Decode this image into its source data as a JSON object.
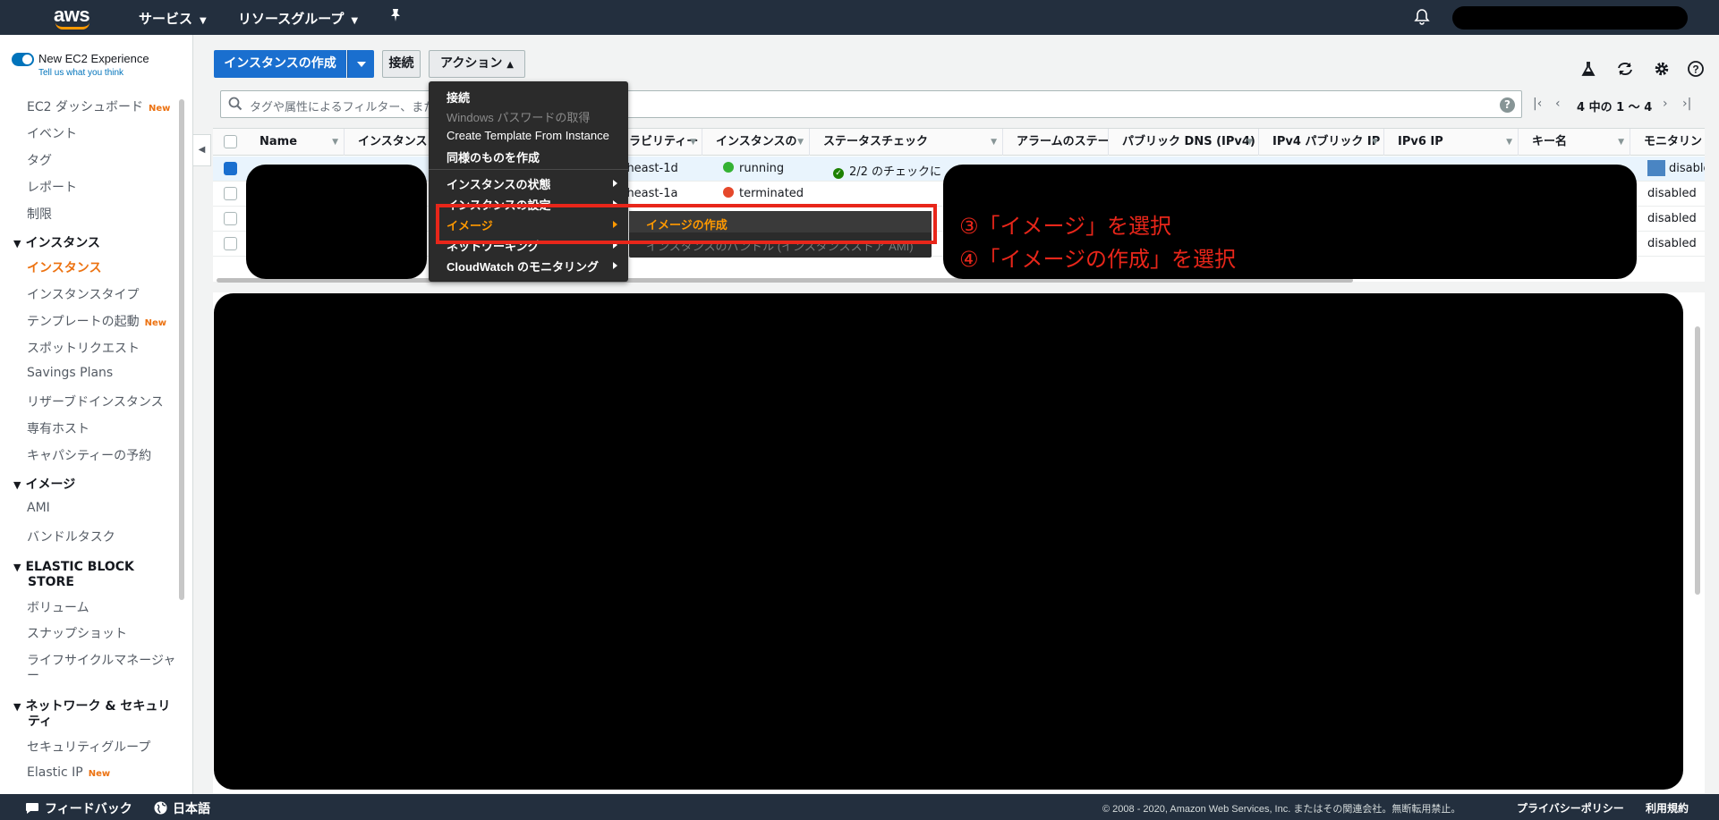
{
  "topnav": {
    "logo": "aws",
    "services": "サービス",
    "resource_groups": "リソースグループ",
    "pin_icon": "pin-icon",
    "bell_icon": "bell-icon"
  },
  "sidebar": {
    "ec2_experience": "New EC2 Experience",
    "feedback_link": "Tell us what you think",
    "new_badge": "New",
    "items_top": [
      "EC2 ダッシュボード",
      "イベント",
      "タグ",
      "レポート",
      "制限"
    ],
    "section_instances": "インスタンス",
    "items_instances": [
      "インスタンス",
      "インスタンスタイプ",
      "テンプレートの起動",
      "スポットリクエスト",
      "Savings Plans",
      "リザーブドインスタンス",
      "専有ホスト",
      "キャパシティーの予約"
    ],
    "section_images": "イメージ",
    "items_images": [
      "AMI",
      "バンドルタスク"
    ],
    "section_ebs_line1": "ELASTIC BLOCK",
    "section_ebs_line2": "STORE",
    "items_ebs": [
      "ボリューム",
      "スナップショット",
      "ライフサイクルマネージャ",
      "ー"
    ],
    "section_network_line1": "ネットワーク & セキュリ",
    "section_network_line2": "ティ",
    "items_network": [
      "セキュリティグループ",
      "Elastic IP"
    ]
  },
  "toolbar": {
    "launch": "インスタンスの作成",
    "connect": "接続",
    "actions": "アクション"
  },
  "filter": {
    "placeholder": "タグや属性によるフィルター、また",
    "pagination": "4 中の 1 〜 4"
  },
  "table": {
    "columns": [
      "Name",
      "インスタンス",
      "イラビリティー",
      "インスタンスの",
      "ステータスチェック",
      "アラームのステー",
      "パブリック DNS (IPv4)",
      "IPv4 パブリック IP",
      "IPv6 IP",
      "キー名",
      "モニタリン"
    ],
    "rows": [
      {
        "az": "rtheast-1d",
        "state": "running",
        "state_color": "#34b233",
        "status_check": "2/2 のチェックに",
        "monitoring": "disable",
        "selected": true
      },
      {
        "az": "rtheast-1a",
        "state": "terminated",
        "state_color": "#e5482b",
        "status_check": "",
        "monitoring": "disabled",
        "selected": false
      },
      {
        "az": "",
        "state": "",
        "status_check": "",
        "monitoring": "disabled",
        "selected": false
      },
      {
        "az": "",
        "state": "",
        "status_check": "",
        "monitoring": "disabled",
        "selected": false
      }
    ]
  },
  "action_menu": {
    "items": [
      "接続",
      "Windows パスワードの取得",
      "Create Template From Instance",
      "同様のものを作成",
      "インスタンスの状態",
      "インスタンスの設定",
      "イメージ",
      "ネットワーキング",
      "CloudWatch のモニタリング"
    ],
    "submenu": [
      "イメージの作成",
      "インスタンスのバンドル (インスタンスストア AMI)"
    ]
  },
  "annotations": {
    "step3": "③「イメージ」を選択",
    "step4": "④「イメージの作成」を選択",
    "color": "#e8261a"
  },
  "footer": {
    "feedback": "フィードバック",
    "language": "日本語",
    "copyright": "© 2008 - 2020, Amazon Web Services, Inc. またはその関連会社。無断転用禁止。",
    "privacy": "プライバシーポリシー",
    "terms": "利用規約"
  }
}
